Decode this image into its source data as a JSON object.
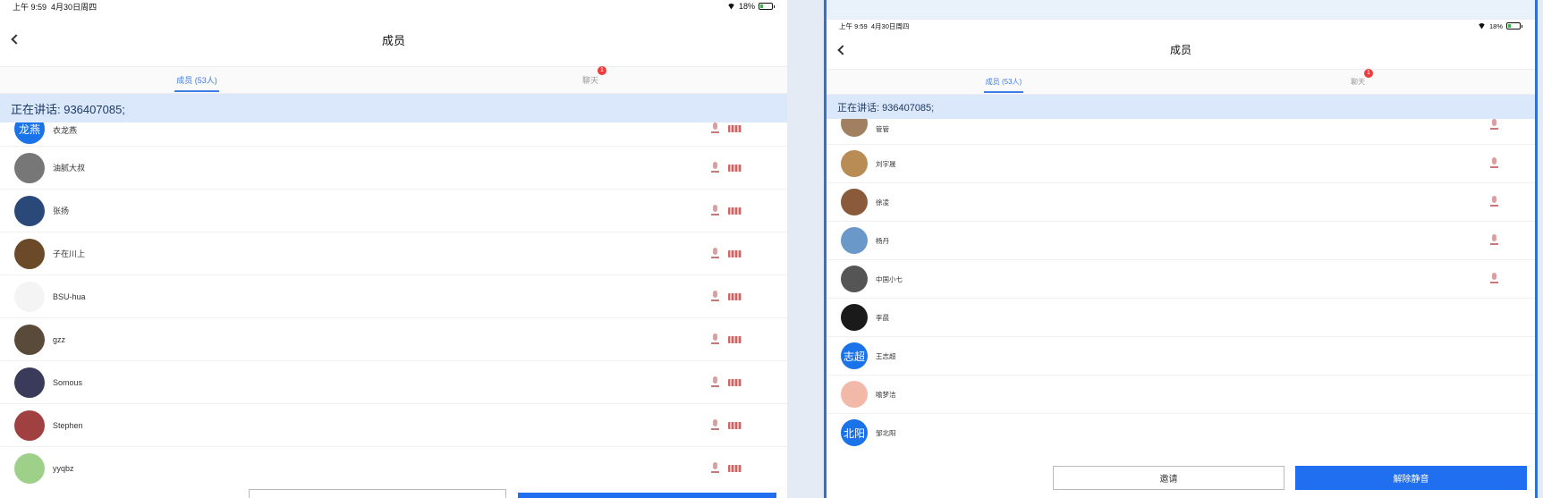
{
  "left": {
    "status": {
      "time": "上午 9:59",
      "date": "4月30日周四",
      "battery": "18%"
    },
    "title": "成员",
    "tabs": [
      {
        "label": "成员 (53人)",
        "active": true
      },
      {
        "label": "聊天",
        "badge": "1",
        "active": false
      }
    ],
    "speaking": "正在讲话: 936407085;",
    "members": [
      {
        "name": "衣龙燕",
        "avatar_text": "龙燕",
        "avatar_color": "#1a73e8",
        "mic": true,
        "cam": true
      },
      {
        "name": "油腻大叔",
        "avatar_text": "",
        "avatar_color": "#777777",
        "mic": true,
        "cam": true
      },
      {
        "name": "张扬",
        "avatar_text": "",
        "avatar_color": "#2a4878",
        "mic": true,
        "cam": true
      },
      {
        "name": "子在川上",
        "avatar_text": "",
        "avatar_color": "#6b4a2a",
        "mic": true,
        "cam": true
      },
      {
        "name": "BSU-hua",
        "avatar_text": "",
        "avatar_color": "#f4f4f4",
        "mic": true,
        "cam": true
      },
      {
        "name": "gzz",
        "avatar_text": "",
        "avatar_color": "#5a4a3a",
        "mic": true,
        "cam": true
      },
      {
        "name": "Somous",
        "avatar_text": "",
        "avatar_color": "#3a3a5a",
        "mic": true,
        "cam": true
      },
      {
        "name": "Stephen",
        "avatar_text": "",
        "avatar_color": "#a04040",
        "mic": true,
        "cam": true
      },
      {
        "name": "yyqbz",
        "avatar_text": "",
        "avatar_color": "#9fd08a",
        "mic": true,
        "cam": true
      }
    ]
  },
  "right": {
    "status": {
      "time": "上午 9:59",
      "date": "4月30日周四",
      "battery": "18%"
    },
    "title": "成员",
    "tabs": [
      {
        "label": "成员 (53人)",
        "active": true
      },
      {
        "label": "聊天",
        "badge": "1",
        "active": false
      }
    ],
    "speaking": "正在讲话: 936407085;",
    "members": [
      {
        "name": "管管",
        "avatar_text": "",
        "avatar_color": "#a08060",
        "mic": true
      },
      {
        "name": "刘宇晟",
        "avatar_text": "",
        "avatar_color": "#b98b55",
        "mic": true
      },
      {
        "name": "徐凌",
        "avatar_text": "",
        "avatar_color": "#8a5a3a",
        "mic": true
      },
      {
        "name": "杨丹",
        "avatar_text": "",
        "avatar_color": "#6a98c8",
        "mic": true
      },
      {
        "name": "中国小七",
        "avatar_text": "",
        "avatar_color": "#555555",
        "mic": true
      },
      {
        "name": "李晨",
        "avatar_text": "",
        "avatar_color": "#1a1a1a",
        "mic": false
      },
      {
        "name": "王志超",
        "avatar_text": "志超",
        "avatar_color": "#1a73e8",
        "mic": false
      },
      {
        "name": "喻梦洁",
        "avatar_text": "",
        "avatar_color": "#f2b8a8",
        "mic": false
      },
      {
        "name": "邹北阳",
        "avatar_text": "北阳",
        "avatar_color": "#1a73e8",
        "mic": false
      }
    ],
    "buttons": {
      "invite": "邀请",
      "unmute": "解除静音"
    }
  }
}
